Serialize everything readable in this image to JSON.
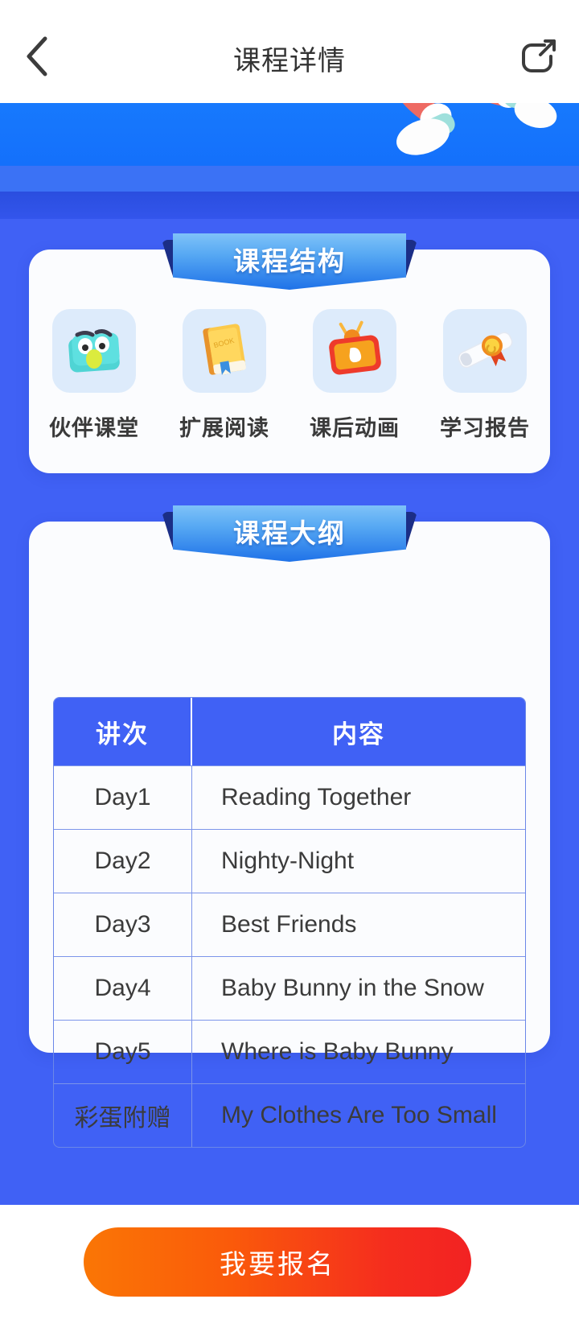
{
  "nav": {
    "back_icon": "chevron-left-icon",
    "title": "课程详情",
    "share_icon": "share-icon"
  },
  "hero": {
    "illustration": "running-legs-3d-illustration",
    "colors": {
      "band_top": "#1779FD",
      "band_mid": "#3B72F5",
      "band_dark": "#2A4EDF",
      "body": "#4061F5"
    }
  },
  "structure_card": {
    "ribbon_title": "课程结构",
    "items": [
      {
        "label": "伙伴课堂",
        "icon": "monster-tablet-icon"
      },
      {
        "label": "扩展阅读",
        "icon": "book-icon"
      },
      {
        "label": "课后动画",
        "icon": "tv-play-icon"
      },
      {
        "label": "学习报告",
        "icon": "diploma-medal-icon"
      }
    ]
  },
  "outline_card": {
    "ribbon_title": "课程大纲",
    "table": {
      "headers": [
        "讲次",
        "内容"
      ],
      "rows": [
        [
          "Day1",
          "Reading Together"
        ],
        [
          "Day2",
          "Nighty-Night"
        ],
        [
          "Day3",
          "Best Friends"
        ],
        [
          "Day4",
          "Baby Bunny in the Snow"
        ],
        [
          "Day5",
          "Where is Baby Bunny"
        ],
        [
          "彩蛋附赠",
          "My Clothes Are Too Small"
        ]
      ]
    }
  },
  "cta": {
    "label": "我要报名",
    "gradient_start": "#FA7605",
    "gradient_end": "#F22222"
  }
}
